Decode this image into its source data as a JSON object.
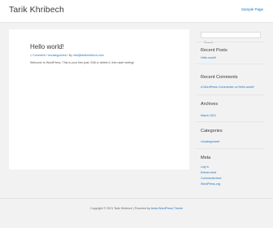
{
  "header": {
    "site_title": "Tarik Khribech",
    "nav_link": "Sample Page"
  },
  "post": {
    "title": "Hello world!",
    "meta": {
      "comments": "1 Comment",
      "separator1": " / ",
      "category": "Uncategorized",
      "separator2": " / By ",
      "author": "info@tarikkhribech.com"
    },
    "body": "Welcome to WordPress. This is your first post. Edit or delete it, then start writing!"
  },
  "sidebar": {
    "search_placeholder": "Search",
    "recent_posts": {
      "title": "Recent Posts",
      "items": [
        "Hello world!"
      ]
    },
    "recent_comments": {
      "title": "Recent Comments",
      "items": [
        "A WordPress Commenter on Hello world!"
      ]
    },
    "archives": {
      "title": "Archives",
      "items": [
        "March 2021"
      ]
    },
    "categories": {
      "title": "Categories",
      "items": [
        "Uncategorized"
      ]
    },
    "meta": {
      "title": "Meta",
      "items": [
        "Log in",
        "Entries feed",
        "Comments feed",
        "WordPress.org"
      ]
    }
  },
  "footer": {
    "prefix": "Copyright © 2021 Tarik Khribech | Powered by ",
    "theme_link": "Astra WordPress Theme"
  },
  "colors": {
    "link": "#1e73be",
    "background": "#f2f2f2",
    "card": "#ffffff"
  }
}
